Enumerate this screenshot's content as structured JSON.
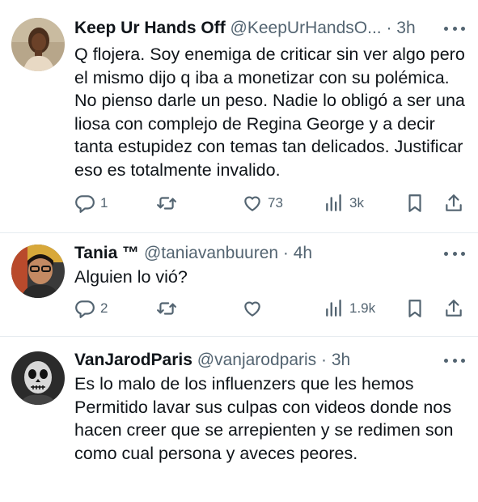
{
  "tweets": [
    {
      "name": "Keep Ur Hands Off",
      "handle": "@KeepUrHandsO...",
      "time": "3h",
      "text": "Q flojera. Soy enemiga de criticar sin ver algo pero el mismo dijo q iba a monetizar con su polémica. No pienso darle un peso. Nadie lo obligó a ser una liosa con complejo de Regina George y a decir tanta estupidez con temas tan delicados. Justificar eso es totalmente invalido.",
      "replies": "1",
      "retweets": "",
      "likes": "73",
      "views": "3k"
    },
    {
      "name": "Tania ™",
      "handle": "@taniavanbuuren",
      "time": "4h",
      "text": "Alguien lo vió?",
      "replies": "2",
      "retweets": "",
      "likes": "",
      "views": "1.9k"
    },
    {
      "name": "VanJarodParis",
      "handle": "@vanjarodparis",
      "time": "3h",
      "text": "Es lo malo de los influenzers que les hemos Permitido lavar sus culpas con videos donde nos hacen creer que se arrepienten y se redimen son como cual persona y aveces peores."
    }
  ],
  "separator": " · ",
  "icons": [
    "reply-icon",
    "retweet-icon",
    "like-icon",
    "views-icon",
    "bookmark-icon",
    "share-icon",
    "more-icon"
  ],
  "colors": {
    "text": "#0f1419",
    "secondary": "#536471",
    "divider": "#e6ecf0"
  }
}
